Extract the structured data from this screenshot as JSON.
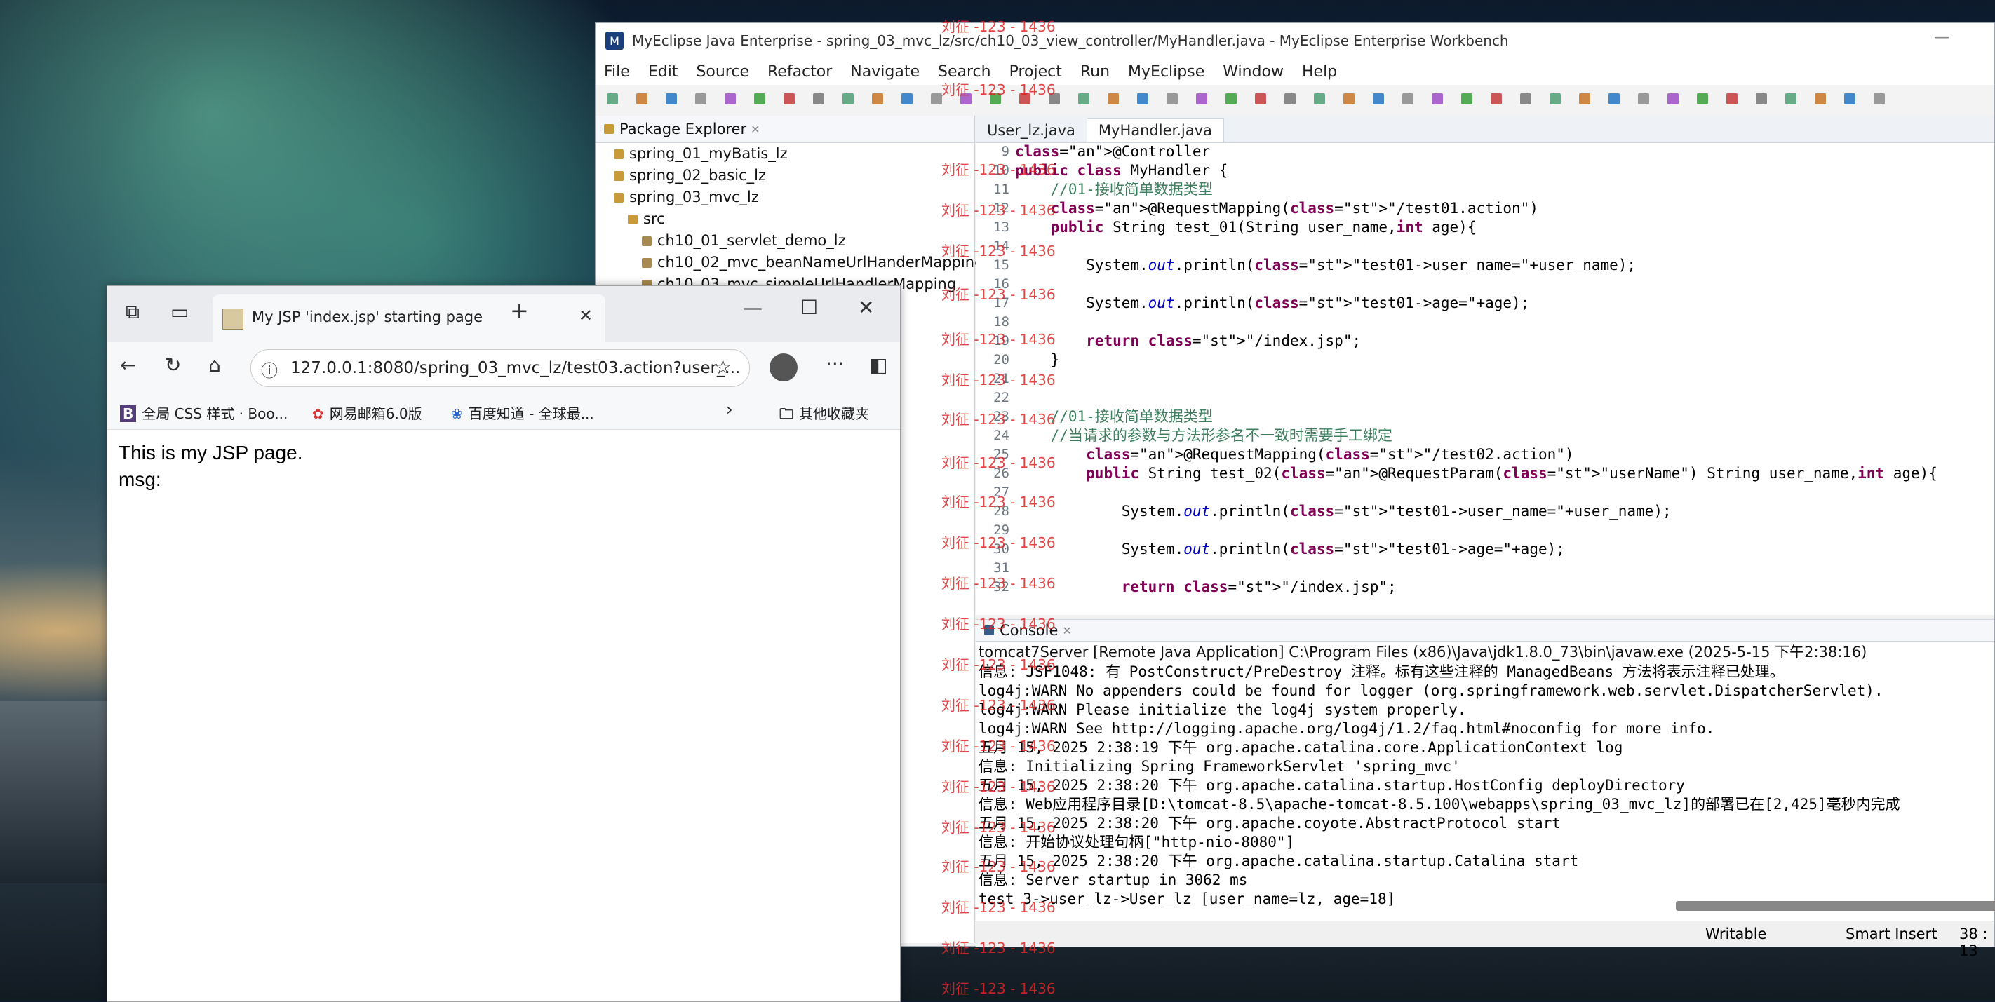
{
  "ide": {
    "title": "MyEclipse Java Enterprise - spring_03_mvc_lz/src/ch10_03_view_controller/MyHandler.java - MyEclipse Enterprise Workbench",
    "menu": [
      "File",
      "Edit",
      "Source",
      "Refactor",
      "Navigate",
      "Search",
      "Project",
      "Run",
      "MyEclipse",
      "Window",
      "Help"
    ],
    "package_explorer": {
      "tab_label": "Package Explorer",
      "items": [
        "spring_01_myBatis_lz",
        "spring_02_basic_lz",
        "spring_03_mvc_lz",
        "src",
        "ch10_01_servlet_demo_lz",
        "ch10_02_mvc_beanNameUrlHanderMapping",
        "ch10_03_mvc_simpleUrlHandlerMapping"
      ]
    },
    "editor": {
      "tabs": [
        "User_lz.java",
        "MyHandler.java"
      ],
      "lines": [
        {
          "n": "9",
          "t": "@Controller"
        },
        {
          "n": "10",
          "t": "public class MyHandler {"
        },
        {
          "n": "11",
          "t": "    //01-接收简单数据类型"
        },
        {
          "n": "12",
          "t": "    @RequestMapping(\"/test01.action\")"
        },
        {
          "n": "13",
          "t": "    public String test_01(String user_name,int age){"
        },
        {
          "n": "14",
          "t": ""
        },
        {
          "n": "15",
          "t": "        System.out.println(\"test01->user_name=\"+user_name);"
        },
        {
          "n": "16",
          "t": ""
        },
        {
          "n": "17",
          "t": "        System.out.println(\"test01->age=\"+age);"
        },
        {
          "n": "18",
          "t": ""
        },
        {
          "n": "19",
          "t": "        return \"/index.jsp\";"
        },
        {
          "n": "20",
          "t": "    }"
        },
        {
          "n": "21",
          "t": ""
        },
        {
          "n": "22",
          "t": ""
        },
        {
          "n": "23",
          "t": "    //01-接收简单数据类型"
        },
        {
          "n": "24",
          "t": "    //当请求的参数与方法形参名不一致时需要手工绑定"
        },
        {
          "n": "25",
          "t": "        @RequestMapping(\"/test02.action\")"
        },
        {
          "n": "26",
          "t": "        public String test_02(@RequestParam(\"userName\") String user_name,int age){"
        },
        {
          "n": "27",
          "t": ""
        },
        {
          "n": "28",
          "t": "            System.out.println(\"test01->user_name=\"+user_name);"
        },
        {
          "n": "29",
          "t": ""
        },
        {
          "n": "30",
          "t": "            System.out.println(\"test01->age=\"+age);"
        },
        {
          "n": "31",
          "t": ""
        },
        {
          "n": "32",
          "t": "            return \"/index.jsp\";"
        }
      ]
    },
    "console": {
      "tab_label": "Console",
      "header": "tomcat7Server [Remote Java Application] C:\\Program Files (x86)\\Java\\jdk1.8.0_73\\bin\\javaw.exe (2025-5-15 下午2:38:16)",
      "lines": [
        "信息: JSF1048: 有 PostConstruct/PreDestroy 注释。标有这些注释的 ManagedBeans 方法将表示注释已处理。",
        "log4j:WARN No appenders could be found for logger (org.springframework.web.servlet.DispatcherServlet).",
        "log4j:WARN Please initialize the log4j system properly.",
        "log4j:WARN See http://logging.apache.org/log4j/1.2/faq.html#noconfig for more info.",
        "五月 15, 2025 2:38:19 下午 org.apache.catalina.core.ApplicationContext log",
        "信息: Initializing Spring FrameworkServlet 'spring_mvc'",
        "五月 15, 2025 2:38:20 下午 org.apache.catalina.startup.HostConfig deployDirectory",
        "信息: Web应用程序目录[D:\\tomcat-8.5\\apache-tomcat-8.5.100\\webapps\\spring_03_mvc_lz]的部署已在[2,425]毫秒内完成",
        "五月 15, 2025 2:38:20 下午 org.apache.coyote.AbstractProtocol start",
        "信息: 开始协议处理句柄[\"http-nio-8080\"]",
        "五月 15, 2025 2:38:20 下午 org.apache.catalina.startup.Catalina start",
        "信息: Server startup in 3062 ms",
        "test_3->user_lz->User_lz [user_name=lz, age=18]"
      ]
    },
    "status": {
      "writable": "Writable",
      "insert": "Smart Insert",
      "position": "38 : 13"
    }
  },
  "browser": {
    "tab_title": "My JSP 'index.jsp' starting page",
    "url": "127.0.0.1:8080/spring_03_mvc_lz/test03.action?user_...",
    "favorites": [
      "全局 CSS 样式 · Boo...",
      "网易邮箱6.0版",
      "百度知道 - 全球最..."
    ],
    "other_favorites": "其他收藏夹",
    "page_lines": [
      "This is my JSP page.",
      "msg:"
    ]
  },
  "watermark": "刘征 -123 - 1436"
}
